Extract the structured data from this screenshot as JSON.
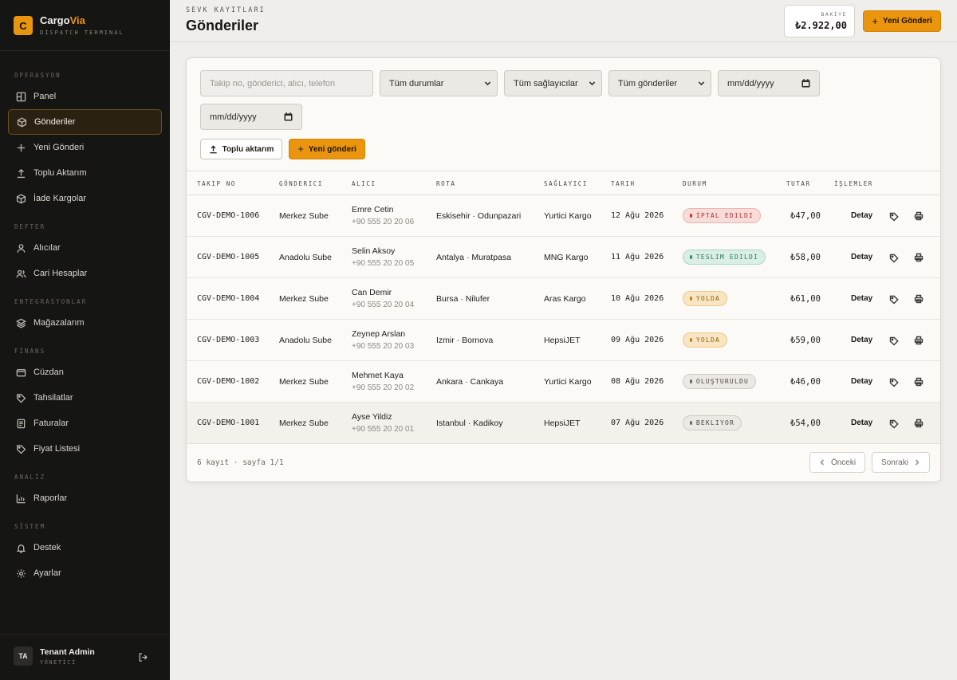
{
  "brand": {
    "logo_letter": "C",
    "name_main": "Cargo",
    "name_accent": "Via",
    "subtitle": "DISPATCH TERMINAL"
  },
  "sidebar": {
    "sections": [
      {
        "label": "OPERASYON"
      },
      {
        "label": "DEFTER"
      },
      {
        "label": "ENTEGRASYONLAR"
      },
      {
        "label": "FİNANS"
      },
      {
        "label": "ANALİZ"
      },
      {
        "label": "SİSTEM"
      }
    ],
    "items": [
      {
        "label": "Panel",
        "icon": "dashboard-icon"
      },
      {
        "label": "Gönderiler",
        "icon": "box-icon",
        "active": true
      },
      {
        "label": "Yeni Gönderi",
        "icon": "plus-icon"
      },
      {
        "label": "Toplu Aktarım",
        "icon": "upload-icon"
      },
      {
        "label": "İade Kargolar",
        "icon": "box-return-icon"
      },
      {
        "label": "Alıcılar",
        "icon": "user-icon"
      },
      {
        "label": "Cari Hesaplar",
        "icon": "users-icon"
      },
      {
        "label": "Mağazalarım",
        "icon": "layers-icon"
      },
      {
        "label": "Cüzdan",
        "icon": "wallet-icon"
      },
      {
        "label": "Tahsilatlar",
        "icon": "tag-icon"
      },
      {
        "label": "Faturalar",
        "icon": "invoice-icon"
      },
      {
        "label": "Fiyat Listesi",
        "icon": "price-tag-icon"
      },
      {
        "label": "Raporlar",
        "icon": "bar-chart-icon"
      },
      {
        "label": "Destek",
        "icon": "bell-icon"
      },
      {
        "label": "Ayarlar",
        "icon": "gear-icon"
      }
    ],
    "user": {
      "initials": "TA",
      "name": "Tenant Admin",
      "role": "YÖNETİCİ"
    }
  },
  "header": {
    "eyebrow": "SEVK KAYITLARI",
    "title": "Gönderiler",
    "balance_label": "BAKİYE",
    "balance_value": "₺2.922,00",
    "new_button": "Yeni Gönderi"
  },
  "filters": {
    "search_placeholder": "Takip no, gönderici, alıcı, telefon",
    "status_select": "Tüm durumlar",
    "provider_select": "Tüm sağlayıcılar",
    "sender_select": "Tüm gönderiler",
    "date_from": "mm/dd/yyyy",
    "date_to": "mm/dd/yyyy",
    "bulk_button": "Toplu aktarım",
    "new_button": "Yeni gönderi"
  },
  "table": {
    "headers": [
      "TAKIP NO",
      "GÖNDERICI",
      "ALICI",
      "ROTA",
      "SAĞLAYICI",
      "TARIH",
      "DURUM",
      "TUTAR",
      "İŞLEMLER"
    ],
    "detail_label": "Detay",
    "rows": [
      {
        "tracking": "CGV-DEMO-1006",
        "sender": "Merkez Sube",
        "recipient": "Emre Cetin",
        "phone": "+90 555 20 20 06",
        "route": "Eskisehir · Odunpazari",
        "provider": "Yurtici Kargo",
        "date": "12 Ağu 2026",
        "status": "İPTAL EDILDI",
        "status_kind": "cancelled",
        "amount": "₺47,00"
      },
      {
        "tracking": "CGV-DEMO-1005",
        "sender": "Anadolu Sube",
        "recipient": "Selin Aksoy",
        "phone": "+90 555 20 20 05",
        "route": "Antalya · Muratpasa",
        "provider": "MNG Kargo",
        "date": "11 Ağu 2026",
        "status": "TESLIM EDILDI",
        "status_kind": "delivered",
        "amount": "₺58,00"
      },
      {
        "tracking": "CGV-DEMO-1004",
        "sender": "Merkez Sube",
        "recipient": "Can Demir",
        "phone": "+90 555 20 20 04",
        "route": "Bursa · Nilufer",
        "provider": "Aras Kargo",
        "date": "10 Ağu 2026",
        "status": "YOLDA",
        "status_kind": "transit",
        "amount": "₺61,00"
      },
      {
        "tracking": "CGV-DEMO-1003",
        "sender": "Anadolu Sube",
        "recipient": "Zeynep Arslan",
        "phone": "+90 555 20 20 03",
        "route": "Izmir · Bornova",
        "provider": "HepsiJET",
        "date": "09 Ağu 2026",
        "status": "YOLDA",
        "status_kind": "transit",
        "amount": "₺59,00"
      },
      {
        "tracking": "CGV-DEMO-1002",
        "sender": "Merkez Sube",
        "recipient": "Mehmet Kaya",
        "phone": "+90 555 20 20 02",
        "route": "Ankara · Cankaya",
        "provider": "Yurtici Kargo",
        "date": "08 Ağu 2026",
        "status": "OLUŞTURULDU",
        "status_kind": "created",
        "amount": "₺46,00"
      },
      {
        "tracking": "CGV-DEMO-1001",
        "sender": "Merkez Sube",
        "recipient": "Ayse Yildiz",
        "phone": "+90 555 20 20 01",
        "route": "Istanbul · Kadikoy",
        "provider": "HepsiJET",
        "date": "07 Ağu 2026",
        "status": "BEKLIYOR",
        "status_kind": "pending",
        "amount": "₺54,00"
      }
    ]
  },
  "footer": {
    "summary": "6 kayıt · sayfa 1/1",
    "prev": "Önceki",
    "next": "Sonraki"
  },
  "colors": {
    "accent": "#ea950d",
    "sidebar_bg": "#151513",
    "cancelled": "#c9312f",
    "delivered": "#2f8a5c",
    "transit": "#c17a0d",
    "neutral": "#6b675f"
  }
}
